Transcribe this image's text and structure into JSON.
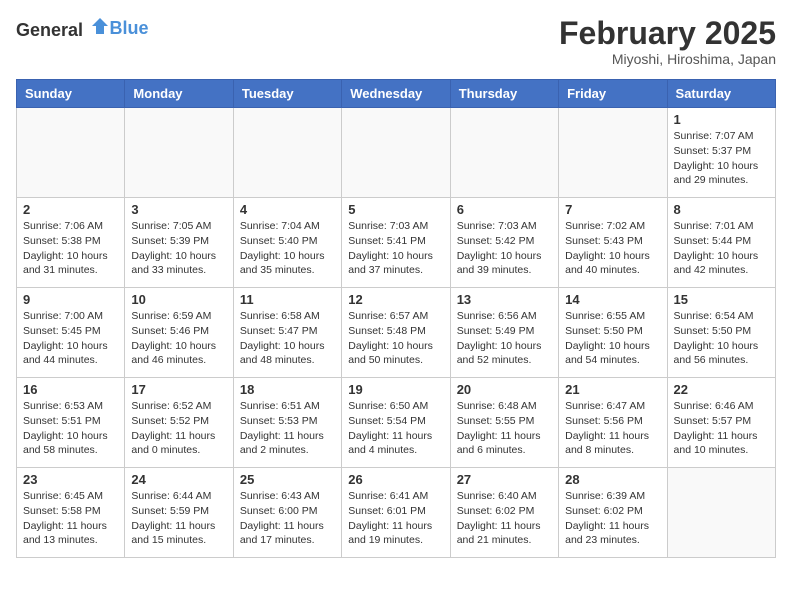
{
  "header": {
    "logo_general": "General",
    "logo_blue": "Blue",
    "month": "February 2025",
    "location": "Miyoshi, Hiroshima, Japan"
  },
  "weekdays": [
    "Sunday",
    "Monday",
    "Tuesday",
    "Wednesday",
    "Thursday",
    "Friday",
    "Saturday"
  ],
  "weeks": [
    [
      {
        "day": "",
        "info": ""
      },
      {
        "day": "",
        "info": ""
      },
      {
        "day": "",
        "info": ""
      },
      {
        "day": "",
        "info": ""
      },
      {
        "day": "",
        "info": ""
      },
      {
        "day": "",
        "info": ""
      },
      {
        "day": "1",
        "info": "Sunrise: 7:07 AM\nSunset: 5:37 PM\nDaylight: 10 hours and 29 minutes."
      }
    ],
    [
      {
        "day": "2",
        "info": "Sunrise: 7:06 AM\nSunset: 5:38 PM\nDaylight: 10 hours and 31 minutes."
      },
      {
        "day": "3",
        "info": "Sunrise: 7:05 AM\nSunset: 5:39 PM\nDaylight: 10 hours and 33 minutes."
      },
      {
        "day": "4",
        "info": "Sunrise: 7:04 AM\nSunset: 5:40 PM\nDaylight: 10 hours and 35 minutes."
      },
      {
        "day": "5",
        "info": "Sunrise: 7:03 AM\nSunset: 5:41 PM\nDaylight: 10 hours and 37 minutes."
      },
      {
        "day": "6",
        "info": "Sunrise: 7:03 AM\nSunset: 5:42 PM\nDaylight: 10 hours and 39 minutes."
      },
      {
        "day": "7",
        "info": "Sunrise: 7:02 AM\nSunset: 5:43 PM\nDaylight: 10 hours and 40 minutes."
      },
      {
        "day": "8",
        "info": "Sunrise: 7:01 AM\nSunset: 5:44 PM\nDaylight: 10 hours and 42 minutes."
      }
    ],
    [
      {
        "day": "9",
        "info": "Sunrise: 7:00 AM\nSunset: 5:45 PM\nDaylight: 10 hours and 44 minutes."
      },
      {
        "day": "10",
        "info": "Sunrise: 6:59 AM\nSunset: 5:46 PM\nDaylight: 10 hours and 46 minutes."
      },
      {
        "day": "11",
        "info": "Sunrise: 6:58 AM\nSunset: 5:47 PM\nDaylight: 10 hours and 48 minutes."
      },
      {
        "day": "12",
        "info": "Sunrise: 6:57 AM\nSunset: 5:48 PM\nDaylight: 10 hours and 50 minutes."
      },
      {
        "day": "13",
        "info": "Sunrise: 6:56 AM\nSunset: 5:49 PM\nDaylight: 10 hours and 52 minutes."
      },
      {
        "day": "14",
        "info": "Sunrise: 6:55 AM\nSunset: 5:50 PM\nDaylight: 10 hours and 54 minutes."
      },
      {
        "day": "15",
        "info": "Sunrise: 6:54 AM\nSunset: 5:50 PM\nDaylight: 10 hours and 56 minutes."
      }
    ],
    [
      {
        "day": "16",
        "info": "Sunrise: 6:53 AM\nSunset: 5:51 PM\nDaylight: 10 hours and 58 minutes."
      },
      {
        "day": "17",
        "info": "Sunrise: 6:52 AM\nSunset: 5:52 PM\nDaylight: 11 hours and 0 minutes."
      },
      {
        "day": "18",
        "info": "Sunrise: 6:51 AM\nSunset: 5:53 PM\nDaylight: 11 hours and 2 minutes."
      },
      {
        "day": "19",
        "info": "Sunrise: 6:50 AM\nSunset: 5:54 PM\nDaylight: 11 hours and 4 minutes."
      },
      {
        "day": "20",
        "info": "Sunrise: 6:48 AM\nSunset: 5:55 PM\nDaylight: 11 hours and 6 minutes."
      },
      {
        "day": "21",
        "info": "Sunrise: 6:47 AM\nSunset: 5:56 PM\nDaylight: 11 hours and 8 minutes."
      },
      {
        "day": "22",
        "info": "Sunrise: 6:46 AM\nSunset: 5:57 PM\nDaylight: 11 hours and 10 minutes."
      }
    ],
    [
      {
        "day": "23",
        "info": "Sunrise: 6:45 AM\nSunset: 5:58 PM\nDaylight: 11 hours and 13 minutes."
      },
      {
        "day": "24",
        "info": "Sunrise: 6:44 AM\nSunset: 5:59 PM\nDaylight: 11 hours and 15 minutes."
      },
      {
        "day": "25",
        "info": "Sunrise: 6:43 AM\nSunset: 6:00 PM\nDaylight: 11 hours and 17 minutes."
      },
      {
        "day": "26",
        "info": "Sunrise: 6:41 AM\nSunset: 6:01 PM\nDaylight: 11 hours and 19 minutes."
      },
      {
        "day": "27",
        "info": "Sunrise: 6:40 AM\nSunset: 6:02 PM\nDaylight: 11 hours and 21 minutes."
      },
      {
        "day": "28",
        "info": "Sunrise: 6:39 AM\nSunset: 6:02 PM\nDaylight: 11 hours and 23 minutes."
      },
      {
        "day": "",
        "info": ""
      }
    ]
  ]
}
